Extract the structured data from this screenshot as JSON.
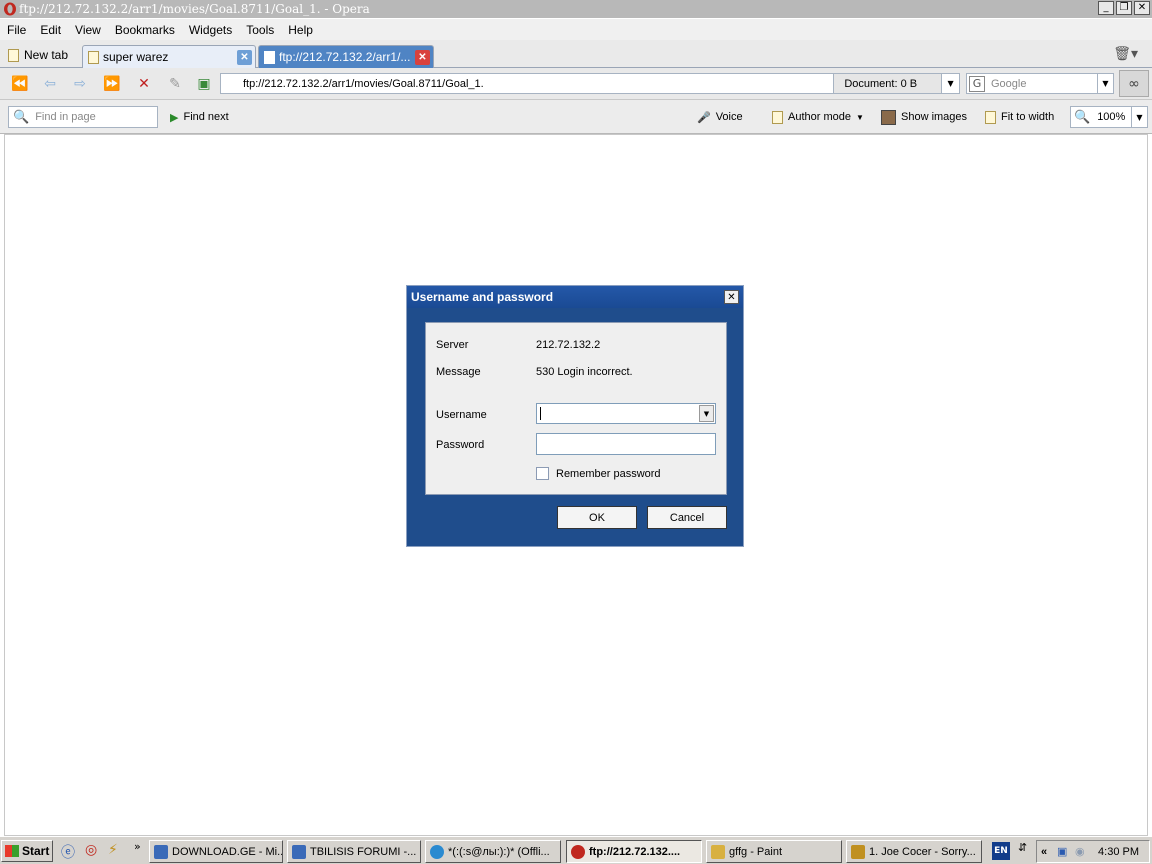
{
  "window": {
    "title": "ftp://212.72.132.2/arr1/movies/Goal.8711/Goal_1. - Opera",
    "buttons": [
      "_",
      "❐",
      "✕"
    ]
  },
  "menu": [
    "File",
    "Edit",
    "View",
    "Bookmarks",
    "Widgets",
    "Tools",
    "Help"
  ],
  "tabs": {
    "new_tab_label": "New tab",
    "items": [
      {
        "label": "super warez",
        "active": false
      },
      {
        "label": "ftp://212.72.132.2/arr1/...",
        "active": true
      }
    ]
  },
  "navbar": {
    "url": "ftp://212.72.132.2/arr1/movies/Goal.8711/Goal_1.",
    "document_size": "Document:  0 B",
    "search_placeholder": "Google"
  },
  "findbar": {
    "find_placeholder": "Find in page",
    "find_next": "Find next",
    "voice": "Voice",
    "author_mode": "Author mode",
    "show_images": "Show images",
    "fit_to_width": "Fit to width",
    "zoom": "100%"
  },
  "dialog": {
    "title": "Username and password",
    "server_label": "Server",
    "server_value": "212.72.132.2",
    "message_label": "Message",
    "message_value": "530 Login incorrect.",
    "username_label": "Username",
    "username_value": "",
    "password_label": "Password",
    "password_value": "",
    "remember_label": "Remember password",
    "remember_checked": false,
    "ok": "OK",
    "cancel": "Cancel"
  },
  "taskbar": {
    "start": "Start",
    "tasks": [
      {
        "label": "DOWNLOAD.GE - Mi...",
        "active": false
      },
      {
        "label": "TBILISIS FORUMI -...",
        "active": false
      },
      {
        "label": "*(:(:s@лы:):)* (Offli...",
        "active": false
      },
      {
        "label": "ftp://212.72.132....",
        "active": true
      },
      {
        "label": "gffg - Paint",
        "active": false
      },
      {
        "label": "1. Joe Cocer - Sorry...",
        "active": false
      }
    ],
    "language": "EN",
    "time": "4:30 PM"
  },
  "colors": {
    "active_tab": "#4f84c4",
    "dialog_frame": "#1f4d8c"
  }
}
